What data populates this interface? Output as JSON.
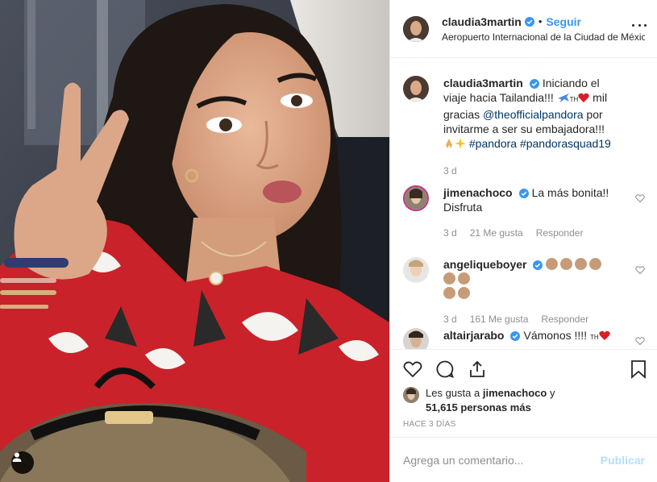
{
  "post": {
    "author": {
      "username": "claudia3martin",
      "verified": true,
      "follow_label": "Seguir",
      "separator": "•",
      "location": "Aeropuerto Internacional de la Ciudad de México"
    },
    "caption": {
      "username": "claudia3martin",
      "text_part1": "Iniciando el viaje hacia Tailandia!!!",
      "text_part2": "mil gracias",
      "mention": "@theofficialpandora",
      "text_part3": "por invitarme a ser su embajadora!!!",
      "hashtag1": "#pandora",
      "hashtag2": "#pandorasquad19",
      "time": "3 d"
    },
    "comments": [
      {
        "username": "jimenachoco",
        "text": "La más bonita!! Disfruta",
        "time": "3 d",
        "likes": "21 Me gusta",
        "reply": "Responder"
      },
      {
        "username": "angeliqueboyer",
        "text": "",
        "time": "3 d",
        "likes": "161 Me gusta",
        "reply": "Responder"
      },
      {
        "username": "altairjarabo",
        "text": "Vámonos !!!!"
      }
    ],
    "likes_summary": {
      "prefix": "Les gusta a",
      "user": "jimenachoco",
      "middle": "y",
      "count": "51,615 personas más"
    },
    "time_ago": "HACE 3 DÍAS",
    "add_comment": {
      "placeholder": "Agrega un comentario...",
      "publish_label": "Publicar"
    },
    "colors": {
      "link": "#3897f0",
      "hashtag": "#003569",
      "muted": "#8e8e8e",
      "publish_disabled": "#b2dffc",
      "heart": "#e0245e"
    },
    "icons": [
      "verified-icon",
      "more-options-icon",
      "heart-icon",
      "comment-icon",
      "share-icon",
      "bookmark-icon",
      "user-tag-icon",
      "airplane-emoji",
      "red-heart-emoji",
      "pray-emoji",
      "sparkles-emoji",
      "clap-emoji"
    ]
  }
}
